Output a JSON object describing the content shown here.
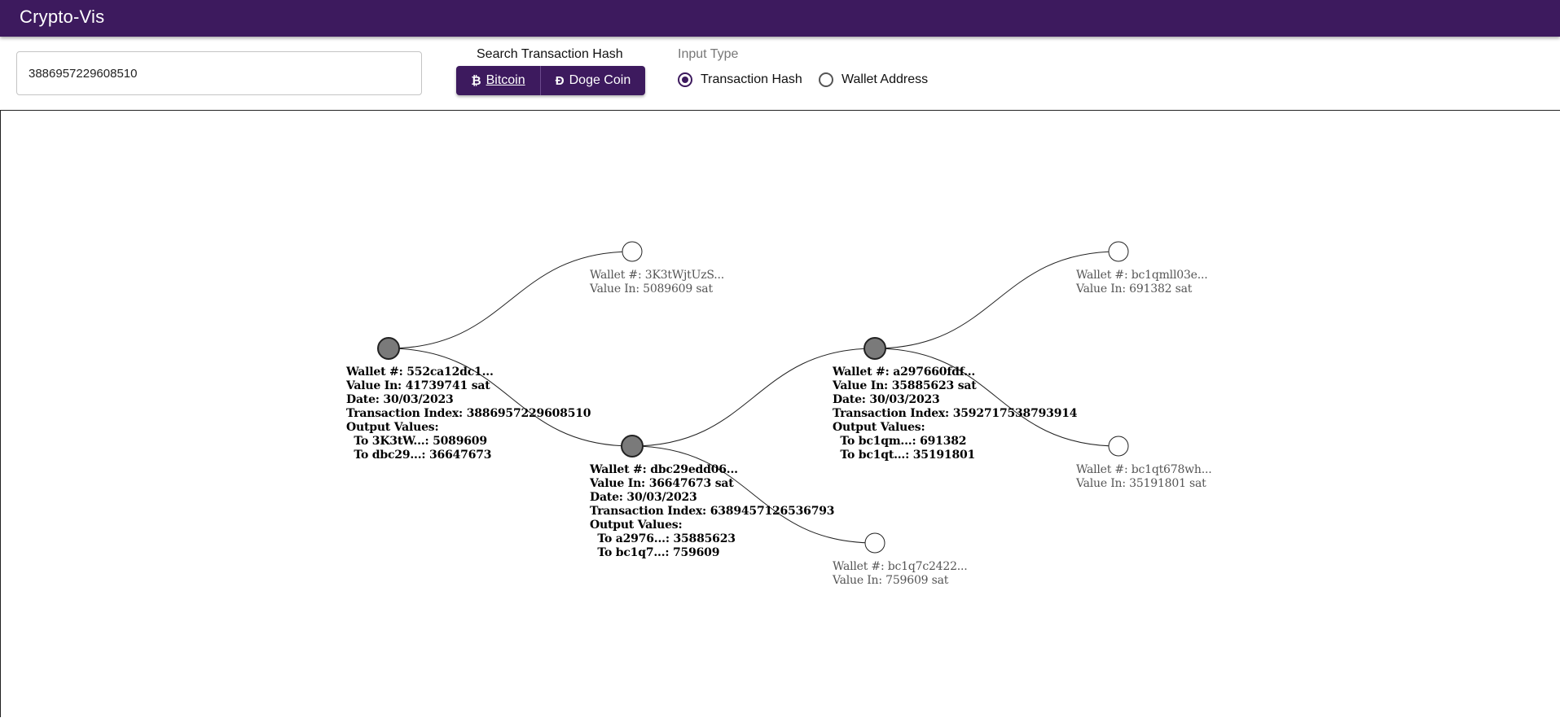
{
  "app": {
    "title": "Crypto-Vis"
  },
  "search": {
    "value": "3886957229608510",
    "label": "Search Transaction Hash"
  },
  "coins": [
    {
      "symbol": "₿",
      "label": "Bitcoin",
      "selected": true
    },
    {
      "symbol": "Ð",
      "label": "Doge Coin",
      "selected": false
    }
  ],
  "input_type": {
    "label": "Input Type",
    "options": [
      {
        "label": "Transaction Hash",
        "checked": true
      },
      {
        "label": "Wallet Address",
        "checked": false
      }
    ]
  },
  "graph": {
    "nodes": [
      {
        "id": "n1",
        "kind": "transaction",
        "lines": [
          "Wallet #: 552ca12dc1...",
          "Value In: 41739741 sat",
          "Date: 30/03/2023",
          "Transaction Index: 3886957229608510",
          "Output Values:",
          "  To 3K3tW...: 5089609",
          "  To dbc29...: 36647673"
        ]
      },
      {
        "id": "n2",
        "kind": "leaf",
        "lines": [
          "Wallet #: 3K3tWjtUzS...",
          "Value In: 5089609 sat"
        ]
      },
      {
        "id": "n3",
        "kind": "transaction",
        "lines": [
          "Wallet #: dbc29edd06...",
          "Value In: 36647673 sat",
          "Date: 30/03/2023",
          "Transaction Index: 6389457126536793",
          "Output Values:",
          "  To a2976...: 35885623",
          "  To bc1q7...: 759609"
        ]
      },
      {
        "id": "n4",
        "kind": "transaction",
        "lines": [
          "Wallet #: a297660fdf...",
          "Value In: 35885623 sat",
          "Date: 30/03/2023",
          "Transaction Index: 3592717538793914",
          "Output Values:",
          "  To bc1qm...: 691382",
          "  To bc1qt...: 35191801"
        ]
      },
      {
        "id": "n5",
        "kind": "leaf",
        "lines": [
          "Wallet #: bc1q7c2422...",
          "Value In: 759609 sat"
        ]
      },
      {
        "id": "n6",
        "kind": "leaf",
        "lines": [
          "Wallet #: bc1qmll03e...",
          "Value In: 691382 sat"
        ]
      },
      {
        "id": "n7",
        "kind": "leaf",
        "lines": [
          "Wallet #: bc1qt678wh...",
          "Value In: 35191801 sat"
        ]
      }
    ],
    "edges": [
      [
        "n1",
        "n2"
      ],
      [
        "n1",
        "n3"
      ],
      [
        "n3",
        "n4"
      ],
      [
        "n3",
        "n5"
      ],
      [
        "n4",
        "n6"
      ],
      [
        "n4",
        "n7"
      ]
    ],
    "colors": {
      "transaction_fill": "#7a7a7a",
      "leaf_fill": "#ffffff",
      "stroke": "#222222"
    }
  }
}
